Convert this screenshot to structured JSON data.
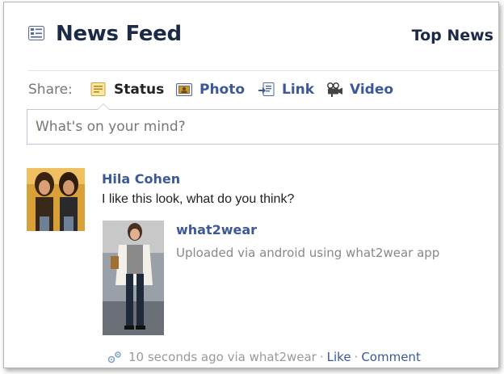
{
  "header": {
    "title": "News Feed",
    "sort_label": "Top News"
  },
  "share": {
    "label": "Share:",
    "items": [
      {
        "label": "Status",
        "icon": "status-icon"
      },
      {
        "label": "Photo",
        "icon": "photo-icon"
      },
      {
        "label": "Link",
        "icon": "link-icon"
      },
      {
        "label": "Video",
        "icon": "video-icon"
      }
    ]
  },
  "composer": {
    "placeholder": "What's on your mind?"
  },
  "story": {
    "author": "Hila Cohen",
    "message": "I like this look, what do you think?",
    "attachment": {
      "title": "what2wear",
      "caption": "Uploaded via android using what2wear app"
    },
    "meta": {
      "time": "10 seconds ago via what2wear",
      "separator": "·",
      "like": "Like",
      "comment": "Comment"
    }
  },
  "colors": {
    "link": "#3b5998",
    "title": "#1c2a47",
    "muted": "#888888"
  }
}
